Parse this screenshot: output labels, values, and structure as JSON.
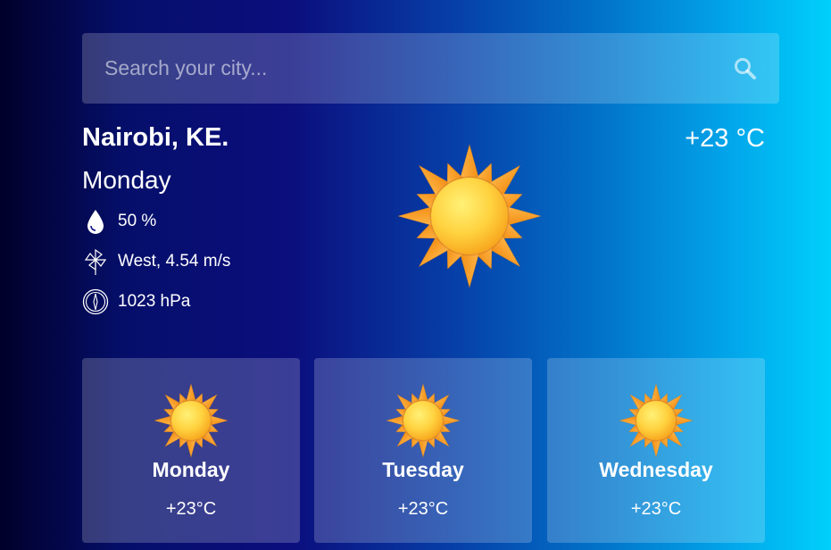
{
  "search": {
    "placeholder": "Search your city...",
    "icon": "search-icon"
  },
  "current": {
    "city": "Nairobi, KE.",
    "day": "Monday",
    "temperature": "+23 °C",
    "humidity": "50 %",
    "wind": "West, 4.54 m/s",
    "pressure": "1023 hPa",
    "condition_icon": "sun-icon"
  },
  "forecast": [
    {
      "day": "Monday",
      "temp": "+23°C",
      "icon": "sun-icon"
    },
    {
      "day": "Tuesday",
      "temp": "+23°C",
      "icon": "sun-icon"
    },
    {
      "day": "Wednesday",
      "temp": "+23°C",
      "icon": "sun-icon"
    }
  ],
  "colors": {
    "sun_core": "#ffd84a",
    "sun_ray": "#f9a225",
    "accent": "#00d0fb"
  }
}
